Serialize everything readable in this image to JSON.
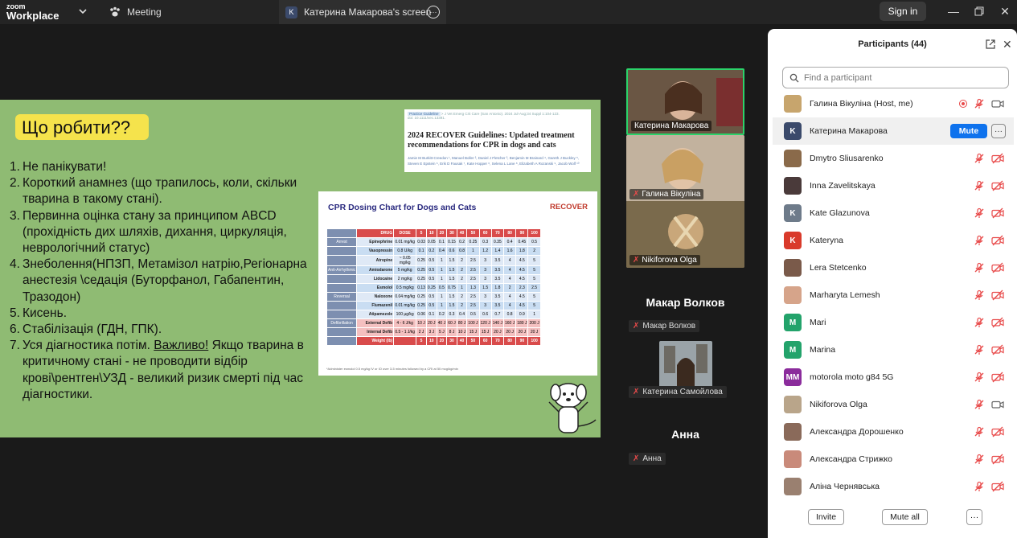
{
  "app": {
    "logo_top": "zoom",
    "logo_bottom": "Workplace"
  },
  "tabs": {
    "meeting": "Meeting",
    "screen": "Катерина Макарова's screen",
    "screen_badge": "K"
  },
  "topbar": {
    "signin": "Sign in"
  },
  "slide": {
    "title": "Що робити??",
    "steps": [
      {
        "num": "1.",
        "text": "Не панікувати!"
      },
      {
        "num": "2.",
        "text": "Короткий анамнез (що трапилось, коли, скільки тварина в такому стані)."
      },
      {
        "num": "3.",
        "text": "Первинна оцінка стану за принципом ABCD (прохідність дих шляхів, дихання, циркуляція, неврологічний статус)"
      },
      {
        "num": "4.",
        "text": "Знеболення(НПЗП, Метамізол натрію,Регіонарна анестезія \\седація (Буторфанол, Габапентин, Тразодон)"
      },
      {
        "num": "5.",
        "text": "Кисень."
      },
      {
        "num": "6.",
        "text": "Стабілізація (ГДН, ГПК)."
      },
      {
        "num": "7.",
        "text_pre": "Уся діагностика потім. ",
        "text_u": "Важливо!",
        "text_post": " Якщо тварина в критичному стані - не проводити відбір крові\\рентген\\УЗД - великий ризик смерті під час діагностики."
      }
    ],
    "paper": {
      "tag": "Practice Guideline",
      "journal": "> J Vet Emerg Crit Care (San Antonio). 2024 Jul-Aug;34 Suppl 1:104-123.",
      "doi": "doi: 10.1111/vec.13391.",
      "title": "2024 RECOVER Guidelines: Updated treatment recommendations for CPR in dogs and cats",
      "authors": "Jamie M Burkitt-Creedon ¹, Manuel Boller ², Daniel J Fletcher ³, Benjamin M Brainard ⁴, Gareth J Buckley ⁵, Steven E Epstein ⁶, Erik D Fausak ⁷, Kate Hopper ⁶, Selena L Lane ⁸, Elizabeth A Rozanski ⁹, Jacob Wolf ¹⁰"
    },
    "cpr_chart": {
      "title": "CPR Dosing Chart for Dogs and Cats",
      "brand": "RECOVER",
      "weights_label": "Weight (lb)",
      "weights": [
        "5",
        "10",
        "20",
        "30",
        "40",
        "50",
        "60",
        "70",
        "80",
        "90",
        "100"
      ],
      "col_drug": "DRUG",
      "col_dose": "DOSE",
      "rows": [
        {
          "group": "Arrest",
          "drug": "Epinephrine",
          "dose": "0.01 mg/kg",
          "vals": [
            "0.03",
            "0.05",
            "0.1",
            "0.15",
            "0.2",
            "0.25",
            "0.3",
            "0.35",
            "0.4",
            "0.45",
            "0.5"
          ]
        },
        {
          "group": "",
          "drug": "Vasopressin",
          "dose": "0.8 U/kg",
          "vals": [
            "0.1",
            "0.2",
            "0.4",
            "0.6",
            "0.8",
            "1",
            "1.2",
            "1.4",
            "1.6",
            "1.8",
            "2"
          ]
        },
        {
          "group": "",
          "drug": "Atropine",
          "dose": "~ 0.05 mg/kg",
          "vals": [
            "0.25",
            "0.5",
            "1",
            "1.5",
            "2",
            "2.5",
            "3",
            "3.5",
            "4",
            "4.5",
            "5"
          ]
        },
        {
          "group": "Anti-Arrhythmic",
          "drug": "Amiodarone",
          "dose": "5 mg/kg",
          "vals": [
            "0.25",
            "0.5",
            "1",
            "1.5",
            "2",
            "2.5",
            "3",
            "3.5",
            "4",
            "4.5",
            "5"
          ]
        },
        {
          "group": "",
          "drug": "Lidocaine",
          "dose": "2 mg/kg",
          "vals": [
            "0.25",
            "0.5",
            "1",
            "1.5",
            "2",
            "2.5",
            "3",
            "3.5",
            "4",
            "4.5",
            "5"
          ]
        },
        {
          "group": "",
          "drug": "Esmolol",
          "dose": "0.5 mg/kg",
          "vals": [
            "0.13",
            "0.25",
            "0.5",
            "0.75",
            "1",
            "1.3",
            "1.5",
            "1.8",
            "2",
            "2.3",
            "2.5"
          ]
        },
        {
          "group": "Reversal",
          "drug": "Naloxone",
          "dose": "0.04 mg/kg",
          "vals": [
            "0.25",
            "0.5",
            "1",
            "1.5",
            "2",
            "2.5",
            "3",
            "3.5",
            "4",
            "4.5",
            "5"
          ]
        },
        {
          "group": "",
          "drug": "Flumazenil",
          "dose": "0.01 mg/kg",
          "vals": [
            "0.25",
            "0.5",
            "1",
            "1.5",
            "2",
            "2.5",
            "3",
            "3.5",
            "4",
            "4.5",
            "5"
          ]
        },
        {
          "group": "",
          "drug": "Atipamezole",
          "dose": "100 µg/kg",
          "vals": [
            "0.06",
            "0.1",
            "0.2",
            "0.3",
            "0.4",
            "0.5",
            "0.6",
            "0.7",
            "0.8",
            "0.9",
            "1"
          ]
        },
        {
          "group": "Defibrillation",
          "drug": "External Defib",
          "dose": "4 - 6 J/kg",
          "vals": [
            "10 J",
            "20 J",
            "40 J",
            "60 J",
            "80 J",
            "100 J",
            "120 J",
            "140 J",
            "160 J",
            "180 J",
            "200 J"
          ],
          "ext": true
        },
        {
          "group": "",
          "drug": "Internal Defib",
          "dose": "0.5 - 1 J/kg",
          "vals": [
            "2 J",
            "3 J",
            "5 J",
            "8 J",
            "10 J",
            "15 J",
            "15 J",
            "20 J",
            "20 J",
            "20 J",
            "20 J"
          ],
          "ext": true
        }
      ],
      "foot_weights": [
        "5",
        "10",
        "20",
        "30",
        "40",
        "50",
        "60",
        "70",
        "80",
        "90",
        "100"
      ],
      "footnote": "*Administer esmolol 0.5 mg/kg IV or IO over 3-5 minutes followed by a CRI at 50 mcg/kg/min"
    }
  },
  "videos": [
    {
      "name": "Катерина Макарова",
      "muted": false,
      "bg": "#5a4a3c",
      "active": true
    },
    {
      "name": "Галина Вікуліна",
      "muted": true,
      "bg": "#b8a590"
    },
    {
      "name": "Nikiforova Olga",
      "muted": true,
      "bg": "#8a7a58"
    }
  ],
  "names_only": [
    {
      "big": "Макар Волков",
      "small": "Макар Волков"
    },
    {
      "small": "Катерина Самойлова"
    },
    {
      "big": "Анна",
      "small": "Анна"
    }
  ],
  "panel": {
    "title": "Participants (44)",
    "search_placeholder": "Find a participant",
    "mute": "Mute",
    "participants": [
      {
        "name": "Галина Вікуліна (Host, me)",
        "initials": "",
        "color": "#c7a56d",
        "rec": true,
        "cam": true
      },
      {
        "name": "Катерина Макарова",
        "initials": "K",
        "color": "#3b4a6b",
        "hl": true
      },
      {
        "name": "Dmytro Sliusarenko",
        "initials": "",
        "color": "#8a6a4a",
        "cam": false
      },
      {
        "name": "Inna Zavelitskaya",
        "initials": "",
        "color": "#4a3a3a",
        "cam": false
      },
      {
        "name": "Kate Glazunova",
        "initials": "K",
        "color": "#6e7b8a",
        "cam": false
      },
      {
        "name": "Kateryna",
        "initials": "K",
        "color": "#d93a2b",
        "cam": false
      },
      {
        "name": "Lera Stetcenko",
        "initials": "",
        "color": "#7a5a4a",
        "cam": false
      },
      {
        "name": "Marharyta Lemesh",
        "initials": "",
        "color": "#d6a48a",
        "cam": false
      },
      {
        "name": "Mari",
        "initials": "M",
        "color": "#23a36b",
        "cam": false
      },
      {
        "name": "Marina",
        "initials": "M",
        "color": "#23a36b",
        "cam": false
      },
      {
        "name": "motorola moto g84 5G",
        "initials": "MM",
        "color": "#8b2c9c",
        "cam": false
      },
      {
        "name": "Nikiforova Olga",
        "initials": "",
        "color": "#b9a58a",
        "cam": true
      },
      {
        "name": "Александра Дорошенко",
        "initials": "",
        "color": "#8a6a5a",
        "cam": false
      },
      {
        "name": "Александра Стрижко",
        "initials": "",
        "color": "#c98a7a",
        "cam": false
      },
      {
        "name": "Аліна Чернявська",
        "initials": "",
        "color": "#9a8070",
        "cam": false
      }
    ],
    "invite": "Invite",
    "mute_all": "Mute all",
    "more": "···"
  }
}
